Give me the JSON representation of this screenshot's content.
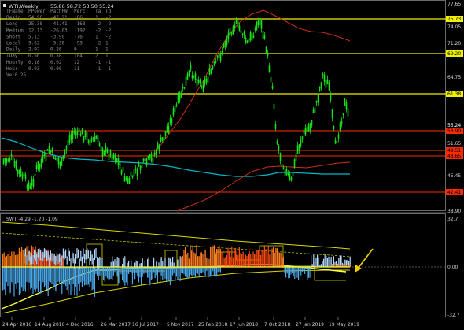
{
  "chart": {
    "title": "WTI,Weekly",
    "ohlc": "55.86 58.72 53.50 55.24",
    "colors": {
      "bg": "#000000",
      "bull": "#18e018",
      "bear": "#18e018",
      "yellow": "#f0f000",
      "red_line": "#ff2a00",
      "teal": "#00b8c8",
      "ma_red": "#c83018"
    }
  },
  "table": {
    "headers": [
      "TFName",
      "PPower",
      "PathPW",
      "Perc",
      "Ta",
      "Td"
    ],
    "rows": [
      [
        "Basic",
        "54.90",
        "-47.21",
        "-86",
        "1",
        "-2"
      ],
      [
        "Long",
        "25.38",
        "-41.41",
        "-163",
        "-2",
        "-2"
      ],
      [
        "Medium",
        "12.13",
        "-26.03",
        "-192",
        "-2",
        "-2"
      ],
      [
        "Short",
        "5.13",
        "-3.90",
        "-76",
        "1",
        "-2"
      ],
      [
        "Local",
        "3.62",
        "-3.36",
        "-93",
        "-2",
        "1"
      ],
      [
        "Daily",
        "2.97",
        "0.26",
        "9",
        "1",
        "1"
      ],
      [
        "IDay",
        "0.56",
        "0.58",
        "104",
        "2",
        "1"
      ],
      [
        "Hourly",
        "0.16",
        "0.02",
        "12",
        "-1",
        "-1"
      ],
      [
        "Hour",
        "0.03",
        "0.00",
        "11",
        "-1",
        "-1"
      ]
    ],
    "footer": "Ve:0.25"
  },
  "price_axis": [
    "77.65",
    "75.73",
    "74.05",
    "71.20",
    "69.20",
    "64.75",
    "61.38",
    "55.24",
    "53.90",
    "51.65",
    "49.51",
    "48.65",
    "45.45",
    "42.41",
    "38.90"
  ],
  "price_markers": [
    {
      "label": "75.73",
      "color": "#f0f000",
      "text_color": "#000000"
    },
    {
      "label": "69.20",
      "color": "#f0f000",
      "text_color": "#000000"
    },
    {
      "label": "61.38",
      "color": "#f0f000",
      "text_color": "#000000"
    },
    {
      "label": "55.24",
      "color": "#000000",
      "text_color": "#ffffff"
    },
    {
      "label": "53.90",
      "color": "#ff2a00",
      "text_color": "#000000"
    },
    {
      "label": "49.51",
      "color": "#ff2a00",
      "text_color": "#000000"
    },
    {
      "label": "48.65",
      "color": "#ff2a00",
      "text_color": "#000000"
    },
    {
      "label": "42.41",
      "color": "#ff2a00",
      "text_color": "#000000"
    }
  ],
  "indicator": {
    "title": "SWT -4.29 -1.20 -1.09",
    "axis": [
      "32.7",
      "0.00",
      "-32.7"
    ]
  },
  "time_axis": [
    "24 Apr 2016",
    "14 Aug 2016",
    "4 Dec 2016",
    "26 Mar 2017",
    "16 Jul 2017",
    "5 Nov 2017",
    "25 Feb 2018",
    "17 Jun 2018",
    "7 Oct 2018",
    "27 Jan 2019",
    "19 May 2019"
  ]
}
